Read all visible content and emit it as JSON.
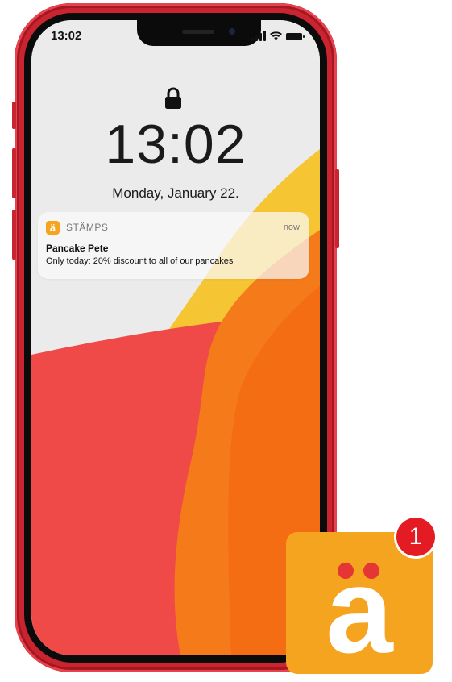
{
  "status_bar": {
    "time": "13:02",
    "icons": [
      "signal-icon",
      "wifi-icon",
      "battery-icon"
    ]
  },
  "lock_screen": {
    "lock_icon": "lock-icon",
    "time": "13:02",
    "date": "Monday, January 22."
  },
  "notification": {
    "app_icon_letter": "ä",
    "app_name": "STÄMPS",
    "time": "now",
    "title": "Pancake Pete",
    "body": "Only today: 20% discount to all of our pancakes"
  },
  "app_icon": {
    "letter": "a",
    "badge_count": "1"
  },
  "colors": {
    "phone_frame": "#c92430",
    "brand_orange": "#f5a41f",
    "badge_red": "#e41b22",
    "wallpaper_red": "#ef4a48",
    "wallpaper_orange": "#f57a1a",
    "wallpaper_yellow": "#f6c533"
  }
}
